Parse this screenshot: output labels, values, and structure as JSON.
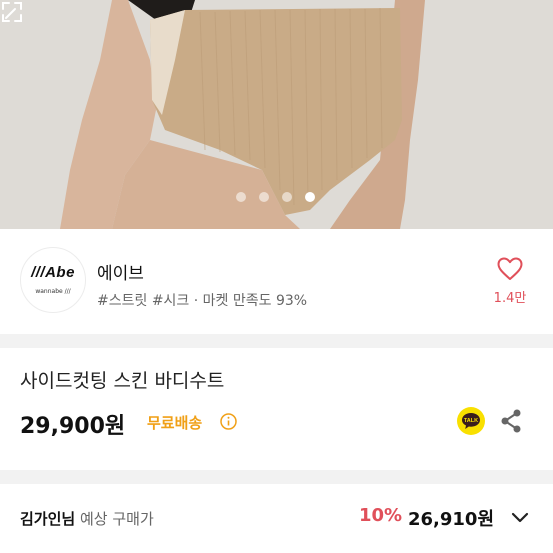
{
  "carousel": {
    "total": 4,
    "active_index": 3
  },
  "seller": {
    "logo_brand": "///Abe",
    "logo_sub": "wannabe ///",
    "name": "에이브",
    "tags": "#스트릿 #시크 · 마켓 만족도 93%",
    "likes": "1.4만"
  },
  "product": {
    "title": "사이드컷팅 스킨 바디수트",
    "price": "29,900원",
    "shipping": "무료배송"
  },
  "buyer": {
    "name": "김가인님",
    "label": "예상 구매가",
    "discount": "10%",
    "price": "26,910원"
  },
  "icons": {
    "like": "heart-icon",
    "expand": "expand-icon",
    "info": "info-icon",
    "talk": "kakao-talk-icon",
    "share": "share-icon",
    "chevron": "chevron-down-icon"
  },
  "colors": {
    "accent": "#e0505a",
    "shipping": "#f0a017",
    "talk": "#f9e000"
  }
}
